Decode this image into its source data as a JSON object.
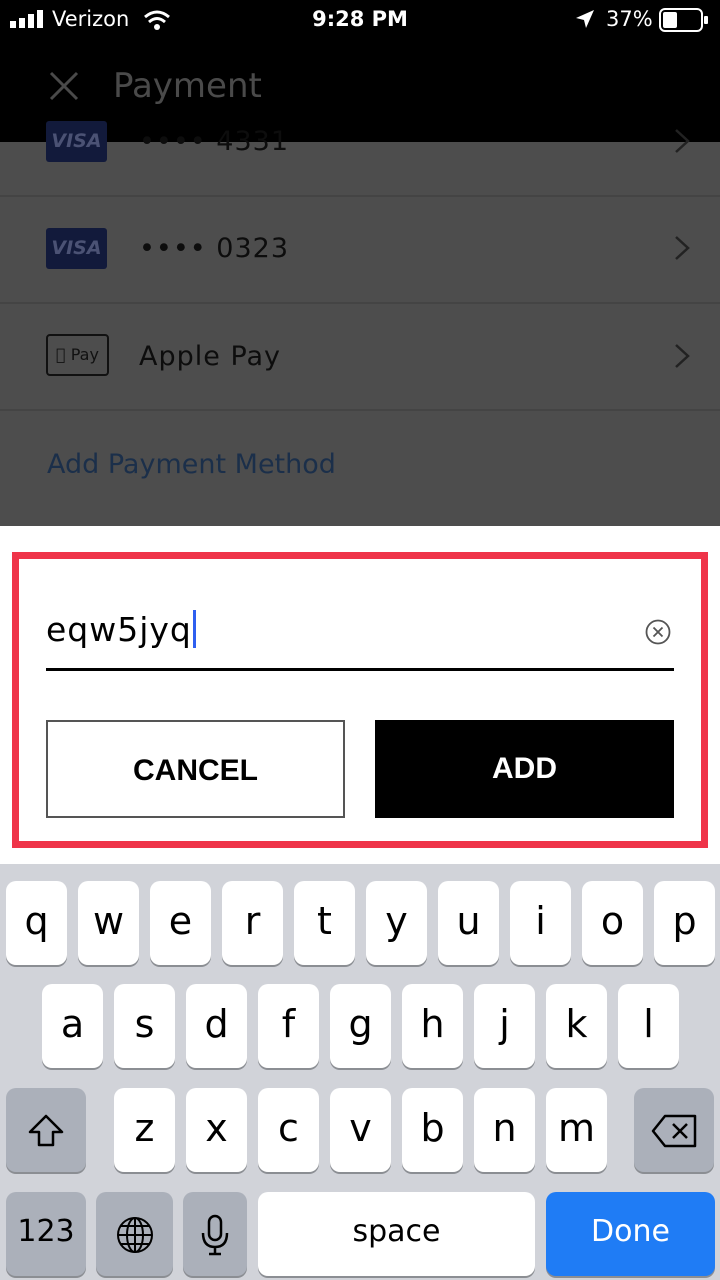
{
  "status_bar": {
    "carrier": "Verizon",
    "time": "9:28 PM",
    "battery": "37%"
  },
  "nav": {
    "title": "Payment",
    "close_icon": "close-icon"
  },
  "payment_list": {
    "partial_row": {
      "brand": "VISA",
      "label": "•••• 4331"
    },
    "rows": [
      {
        "brand": "VISA",
        "label": "•••• 0323"
      },
      {
        "brand": "Pay",
        "label": "Apple Pay"
      }
    ],
    "add_method": "Add Payment Method"
  },
  "dialog": {
    "input_value": "eqw5jyq",
    "cancel_label": "CANCEL",
    "add_label": "ADD",
    "border_color": "#ef3449"
  },
  "keyboard": {
    "row1": [
      "q",
      "w",
      "e",
      "r",
      "t",
      "y",
      "u",
      "i",
      "o",
      "p"
    ],
    "row2": [
      "a",
      "s",
      "d",
      "f",
      "g",
      "h",
      "j",
      "k",
      "l"
    ],
    "row3": [
      "z",
      "x",
      "c",
      "v",
      "b",
      "n",
      "m"
    ],
    "numbers_label": "123",
    "space_label": "space",
    "done_label": "Done"
  }
}
